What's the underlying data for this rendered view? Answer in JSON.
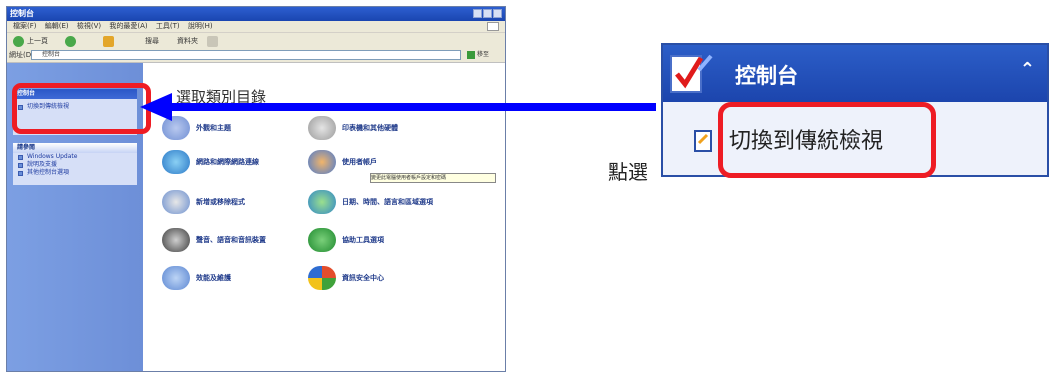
{
  "window": {
    "title": "控制台",
    "menu": [
      "檔案(F)",
      "編輯(E)",
      "檢視(V)",
      "我的最愛(A)",
      "工具(T)",
      "說明(H)"
    ],
    "toolbar": {
      "back": "上一頁",
      "search": "搜尋",
      "folders": "資料夾"
    },
    "address_label": "網址(D)",
    "address_value": "控制台",
    "go_label": "移至"
  },
  "sidebar": {
    "panel1_title": "控制台",
    "switch_classic": "切換到傳統檢視",
    "panel2_title": "請參閱",
    "see_also": [
      "Windows Update",
      "說明及支援",
      "其他控制台選項"
    ]
  },
  "main": {
    "title": "選取類別目錄",
    "categories": [
      {
        "label": "外觀和主題",
        "icon": "appearance-icon"
      },
      {
        "label": "印表機和其他硬體",
        "icon": "printers-icon"
      },
      {
        "label": "網路和網際網路連線",
        "icon": "network-icon"
      },
      {
        "label": "使用者帳戶",
        "icon": "user-accounts-icon"
      },
      {
        "label": "新增或移除程式",
        "icon": "add-remove-icon"
      },
      {
        "label": "日期、時間、語言和區域選項",
        "icon": "date-time-icon"
      },
      {
        "label": "聲音、語音和音訊裝置",
        "icon": "sound-icon"
      },
      {
        "label": "協助工具選項",
        "icon": "accessibility-icon"
      },
      {
        "label": "效能及維護",
        "icon": "performance-icon"
      },
      {
        "label": "資訊安全中心",
        "icon": "security-center-icon"
      }
    ],
    "tooltip": "變更此電腦使用者帳戶設定和密碼"
  },
  "zoom": {
    "title": "控制台",
    "item": "切換到傳統檢視",
    "collapse_glyph": "⌃"
  },
  "instruction": "點選",
  "colors": {
    "highlight": "#ee1c24",
    "arrow": "#0000ff",
    "panel_header": "#1c45ad"
  }
}
